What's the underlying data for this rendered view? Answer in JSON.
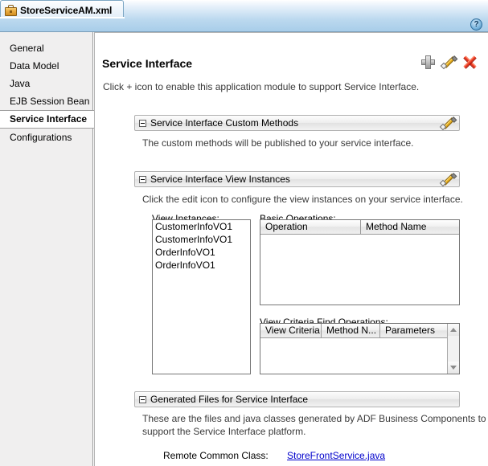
{
  "window": {
    "tab_label": "StoreServiceAM.xml",
    "tab_icon": "briefcase-icon",
    "help_label": "?"
  },
  "sidebar": {
    "items": [
      {
        "label": "General",
        "selected": false
      },
      {
        "label": "Data Model",
        "selected": false
      },
      {
        "label": "Java",
        "selected": false
      },
      {
        "label": "EJB Session Bean",
        "selected": false
      },
      {
        "label": "Service Interface",
        "selected": true
      },
      {
        "label": "Configurations",
        "selected": false
      }
    ]
  },
  "page": {
    "title": "Service Interface",
    "subtitle": "Click + icon to enable this application module to support Service Interface.",
    "tools": [
      {
        "name": "add-icon",
        "label": "+"
      },
      {
        "name": "edit-icon",
        "label": "Edit"
      },
      {
        "name": "delete-icon",
        "label": "Delete"
      }
    ]
  },
  "sections": {
    "custom_methods": {
      "title": "Service Interface Custom Methods",
      "description": "The custom methods will be published to your service interface."
    },
    "view_instances": {
      "title": "Service Interface View Instances",
      "description": "Click the edit icon to configure the view instances on your service interface.",
      "view_instances_label": "View Instances:",
      "view_instances": [
        "CustomerInfoVO1",
        "CustomerInfoVO1",
        "OrderInfoVO1",
        "OrderInfoVO1"
      ],
      "basic_operations_label": "Basic Operations:",
      "basic_operations_columns": [
        "Operation",
        "Method Name"
      ],
      "basic_operations_rows": [],
      "view_criteria_label": "View Criteria Find Operations:",
      "view_criteria_columns": [
        "View Criteria",
        "Method N...",
        "Parameters"
      ],
      "view_criteria_rows": []
    },
    "generated_files": {
      "title": "Generated Files for Service Interface",
      "description_line1": "These are the files and java classes generated by ADF Business Components to",
      "description_line2": "support the Service Interface platform.",
      "remote_common_class_label": "Remote Common Class:",
      "remote_common_class_link": "StoreFrontService.java"
    }
  },
  "colors": {
    "tab_gradient_top": "#ffffff",
    "tab_gradient_bottom": "#a8cde9",
    "sidebar_bg": "#f0efef",
    "link": "#0000cc",
    "delete_red": "#d31b0a",
    "pencil_yellow": "#f5c02a"
  }
}
